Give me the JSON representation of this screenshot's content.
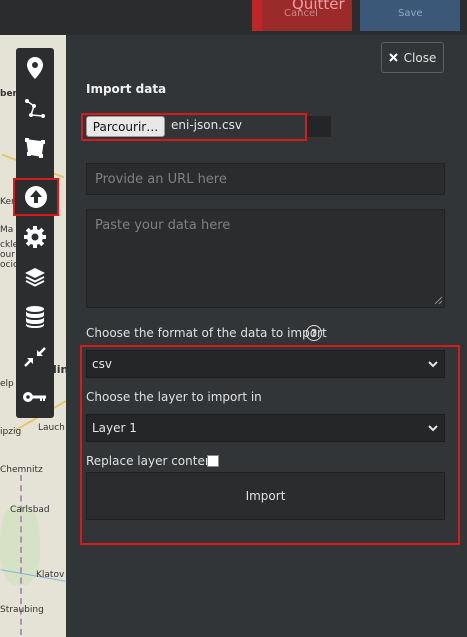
{
  "topbar": {
    "quit_label": "Quitter",
    "cancel_label": "Cancel",
    "save_label": "Save"
  },
  "map": {
    "labels": [
      "bers",
      "Ker",
      "Ma",
      "ckle",
      "our",
      "ocic",
      "orlin",
      "elp",
      "ipzig",
      "Lauch",
      "Chemnitz",
      "Carlsbad",
      "Klatov",
      "Straubing"
    ]
  },
  "toolbar": {
    "items": [
      {
        "icon": "map-marker-icon"
      },
      {
        "icon": "polyline-icon"
      },
      {
        "icon": "polygon-icon"
      },
      {
        "icon": "upload-icon",
        "active": true
      },
      {
        "icon": "gear-icon"
      },
      {
        "icon": "layers-icon"
      },
      {
        "icon": "database-icon"
      },
      {
        "icon": "expand-arrows-icon"
      },
      {
        "icon": "key-icon"
      }
    ]
  },
  "panel": {
    "close_label": "Close",
    "title": "Import data",
    "file_button_label": "Parcourir…",
    "file_name": "eni-json.csv",
    "url_placeholder": "Provide an URL here",
    "paste_placeholder": "Paste your data here",
    "format_label": "Choose the format of the data to import",
    "format_value": "csv",
    "layer_label": "Choose the layer to import in",
    "layer_value": "Layer 1",
    "replace_label": "Replace layer content",
    "replace_checked": false,
    "import_label": "Import"
  },
  "colors": {
    "highlight_red": "#d91a1a",
    "panel_bg": "#323537",
    "quit_red": "#9b2a2a",
    "save_blue": "#3b5878"
  }
}
